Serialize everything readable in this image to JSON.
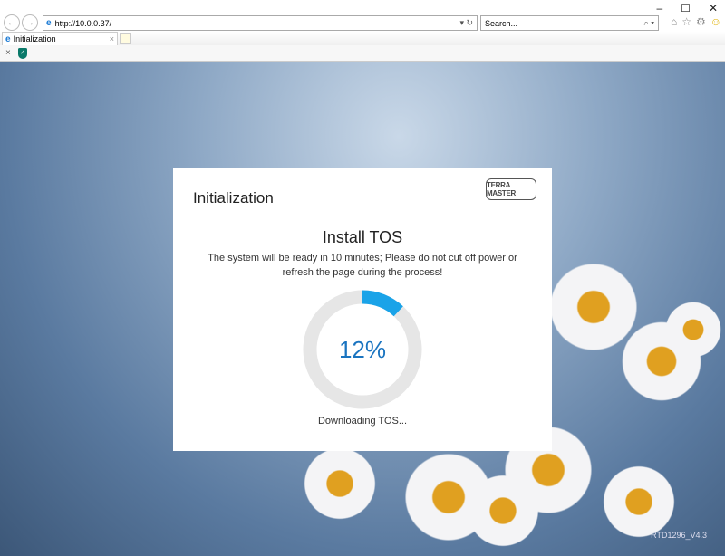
{
  "browser": {
    "url": "http://10.0.0.37/",
    "search_placeholder": "Search...",
    "tab_title": "Initialization",
    "window_controls": [
      "–",
      "☐",
      "✕"
    ]
  },
  "card": {
    "title": "Initialization",
    "logo": "TERRAMASTER",
    "heading": "Install TOS",
    "message": "The system will be ready in 10 minutes; Please do not cut off power or refresh the page during the process!",
    "progress_percent": 12,
    "progress_label": "12%",
    "status": "Downloading TOS...",
    "accent": "#1aa3e8"
  },
  "footer": {
    "version": "RTD1296_V4.3"
  }
}
